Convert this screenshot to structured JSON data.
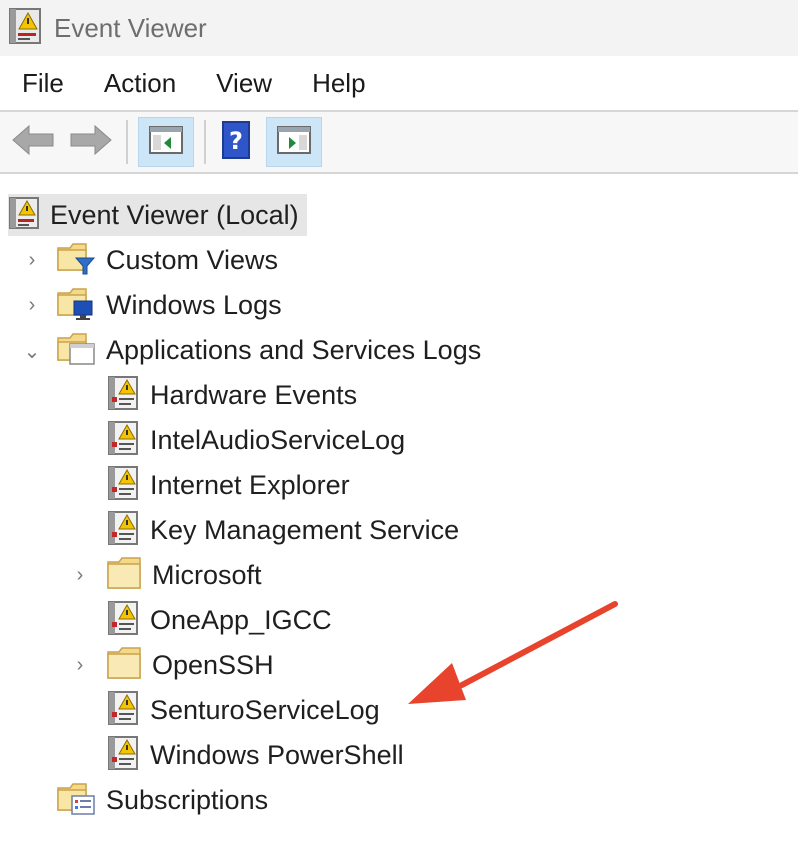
{
  "window": {
    "title": "Event Viewer"
  },
  "menu": {
    "items": [
      "File",
      "Action",
      "View",
      "Help"
    ]
  },
  "toolbar": {
    "back_icon": "back-arrow-icon",
    "forward_icon": "forward-arrow-icon",
    "show_hide_console_tree_icon": "console-tree-icon",
    "help_icon": "help-icon",
    "show_hide_action_pane_icon": "action-pane-icon"
  },
  "tree": {
    "root": {
      "label": "Event Viewer (Local)",
      "icon": "event-viewer-icon",
      "selected": true
    },
    "items": [
      {
        "label": "Custom Views",
        "icon": "filter-folder-icon",
        "expand": "collapsed"
      },
      {
        "label": "Windows Logs",
        "icon": "windows-logs-folder-icon",
        "expand": "collapsed"
      },
      {
        "label": "Applications and Services Logs",
        "icon": "open-folder-icon",
        "expand": "expanded"
      },
      {
        "label": "Hardware Events",
        "icon": "log-icon"
      },
      {
        "label": "IntelAudioServiceLog",
        "icon": "log-icon"
      },
      {
        "label": "Internet Explorer",
        "icon": "log-icon"
      },
      {
        "label": "Key Management Service",
        "icon": "log-icon"
      },
      {
        "label": "Microsoft",
        "icon": "folder-icon",
        "expand": "collapsed"
      },
      {
        "label": "OneApp_IGCC",
        "icon": "log-icon"
      },
      {
        "label": "OpenSSH",
        "icon": "folder-icon",
        "expand": "collapsed"
      },
      {
        "label": "SenturoServiceLog",
        "icon": "log-icon"
      },
      {
        "label": "Windows PowerShell",
        "icon": "log-icon"
      },
      {
        "label": "Subscriptions",
        "icon": "subscriptions-icon"
      }
    ]
  },
  "annotation": {
    "icon": "red-arrow-icon",
    "color": "#e8432c"
  },
  "colors": {
    "selection": "#e6e6e6",
    "toggle_bg": "#cde6f7",
    "arrow": "#e8432c"
  }
}
